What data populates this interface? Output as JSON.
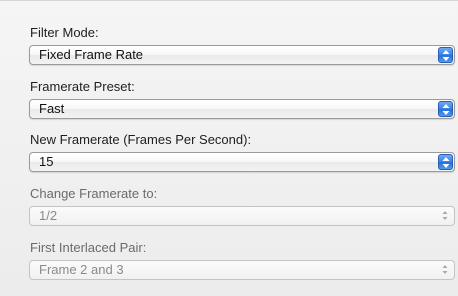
{
  "fields": [
    {
      "label": "Filter Mode:",
      "value": "Fixed Frame Rate",
      "enabled": true
    },
    {
      "label": "Framerate Preset:",
      "value": "Fast",
      "enabled": true
    },
    {
      "label": "New Framerate (Frames Per Second):",
      "value": "15",
      "enabled": true
    },
    {
      "label": "Change Framerate to:",
      "value": "1/2",
      "enabled": false
    },
    {
      "label": "First Interlaced Pair:",
      "value": "Frame 2 and 3",
      "enabled": false
    }
  ],
  "colors": {
    "accent": "#3f86e8",
    "disabled_text": "#8a8a8a"
  },
  "icons": {
    "stepper": "up-down-arrows-icon"
  }
}
